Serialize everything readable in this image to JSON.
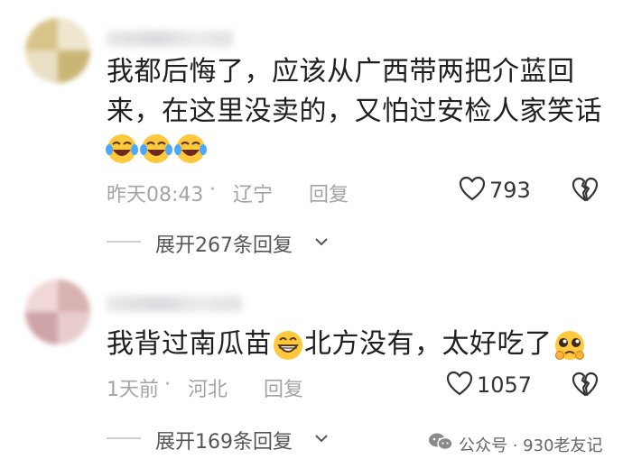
{
  "comments": [
    {
      "text_line1": "我都后悔了，应该从广西带两把介蓝回",
      "text_line2": "来，在这里没卖的，又怕过安检人家笑话",
      "emojis": [
        "crying-laughing-face",
        "crying-laughing-face",
        "crying-laughing-face"
      ],
      "time": "昨天08:43",
      "separator": "·",
      "location": "辽宁",
      "reply_label": "回复",
      "likes": "793",
      "expand_label": "展开267条回复"
    },
    {
      "text_before_emoji": "我背过南瓜苗",
      "text_after_emoji": "北方没有，太好吃了",
      "emojis": [
        "grinning-face",
        "pleading-face"
      ],
      "time": "1天前",
      "separator": "·",
      "location": "河北",
      "reply_label": "回复",
      "likes": "1057",
      "expand_label": "展开169条回复"
    }
  ],
  "watermark": {
    "text": "公众号 · 930老友记",
    "icon": "wechat-icon"
  },
  "colors": {
    "meta": "#a4a4a4",
    "text": "#202020",
    "emoji_yellow": "#ffc83d"
  }
}
